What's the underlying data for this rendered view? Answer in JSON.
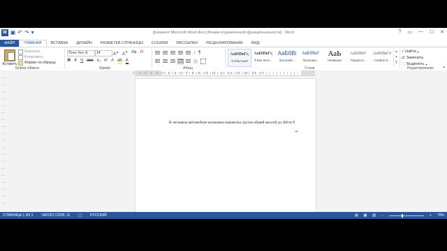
{
  "window": {
    "title": "Документ Microsoft Word.docx [Режим ограниченной функциональности] - Word"
  },
  "tabs": [
    {
      "label": "ФАЙЛ"
    },
    {
      "label": "ГЛАВНАЯ"
    },
    {
      "label": "ВСТАВКА"
    },
    {
      "label": "ДИЗАЙН"
    },
    {
      "label": "РАЗМЕТКА СТРАНИЦЫ"
    },
    {
      "label": "ССЫЛКИ"
    },
    {
      "label": "РАССЫЛКИ"
    },
    {
      "label": "РЕЦЕНЗИРОВАНИЕ"
    },
    {
      "label": "ВИД"
    }
  ],
  "clipboard": {
    "paste_label": "Вставить",
    "cut_label": "Вырезать",
    "copy_label": "Копировать",
    "format_painter_label": "Формат по образцу",
    "group_label": "Буфер обмена"
  },
  "font": {
    "name": "Times New R",
    "size": "14",
    "group_label": "Шрифт"
  },
  "paragraph": {
    "group_label": "Абзац"
  },
  "styles": {
    "group_label": "Стили",
    "items": [
      {
        "preview": "АаБбВвГг,",
        "name": "¶ Обычный"
      },
      {
        "preview": "АаБбВвГг,",
        "name": "¶ Без инте..."
      },
      {
        "preview": "АаБбВі",
        "name": "Заголово..."
      },
      {
        "preview": "АаБбВеГ",
        "name": "Заголово..."
      },
      {
        "preview": "АаЬ",
        "name": "Название"
      },
      {
        "preview": "АаБбВвГ",
        "name": "Подзагол..."
      },
      {
        "preview": "АаБбВвГд",
        "name": "Слабое в..."
      }
    ]
  },
  "editing": {
    "find_label": "Найти",
    "replace_label": "Заменить",
    "select_label": "Выделить",
    "group_label": "Редактирование"
  },
  "ruler": {
    "numbers": "1 · 2 · 1 · 1 · 2 · 3 · 4 · 5 · 6 · 7 · 8 · 9 · 10 · 11 · 12 · 13 · 14 · 15 · 16 · 17"
  },
  "document": {
    "text": "В легковом автомобиле возможна перевозка грузов общей массой до 400 кг.",
    "pilcrow": "¶"
  },
  "status": {
    "page": "СТРАНИЦА 1 ИЗ 1",
    "words": "ЧИСЛО СЛОВ: 11",
    "language": "РУССКИЙ",
    "zoom": "70%",
    "zoom_fraction": 0.35
  },
  "colors": {
    "accent": "#2b579a"
  }
}
